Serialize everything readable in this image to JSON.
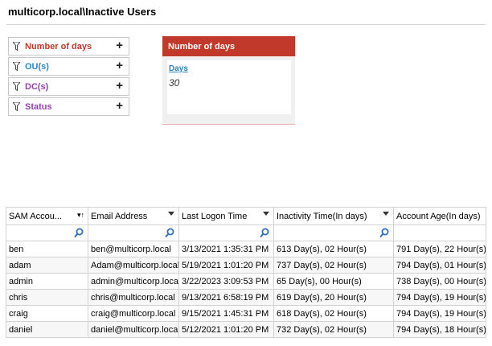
{
  "header": {
    "title": "multicorp.local\\Inactive Users"
  },
  "filters": [
    {
      "label": "Number of days",
      "color": "#c0392b"
    },
    {
      "label": "OU(s)",
      "color": "#2e86c1"
    },
    {
      "label": "DC(s)",
      "color": "#8e44ad"
    },
    {
      "label": "Status",
      "color": "#8e44ad"
    }
  ],
  "popup": {
    "title": "Number of days",
    "field_label": "Days",
    "field_value": "30"
  },
  "table": {
    "columns": [
      "SAM Accou...",
      "Email Address",
      "Last Logon Time",
      "Inactivity Time(In days)",
      "Account Age(In days)"
    ],
    "rows": [
      [
        "ben",
        "ben@multicorp.local",
        "3/13/2021 1:35:31 PM",
        "613 Day(s), 02 Hour(s)",
        "791 Day(s), 22 Hour(s)"
      ],
      [
        "adam",
        "Adam@multicorp.local",
        "5/19/2021 1:01:20 PM",
        "737 Day(s), 02 Hour(s)",
        "794 Day(s), 01 Hour(s)"
      ],
      [
        "admin",
        "admin@multicorp.local",
        "3/22/2023 3:09:53 PM",
        "65 Day(s), 00 Hour(s)",
        "738 Day(s), 00 Hour(s)"
      ],
      [
        "chris",
        "chris@multicorp.local",
        "9/13/2021 6:58:19 PM",
        "619 Day(s), 20 Hour(s)",
        "794 Day(s), 19 Hour(s)"
      ],
      [
        "craig",
        "craig@multicorp.local",
        "9/15/2021 1:45:31 PM",
        "618 Day(s), 02 Hour(s)",
        "794 Day(s), 19 Hour(s)"
      ],
      [
        "daniel",
        "daniel@multicorp.local",
        "5/12/2021 1:01:20 PM",
        "732 Day(s), 02 Hour(s)",
        "794 Day(s), 18 Hour(s)"
      ]
    ]
  }
}
